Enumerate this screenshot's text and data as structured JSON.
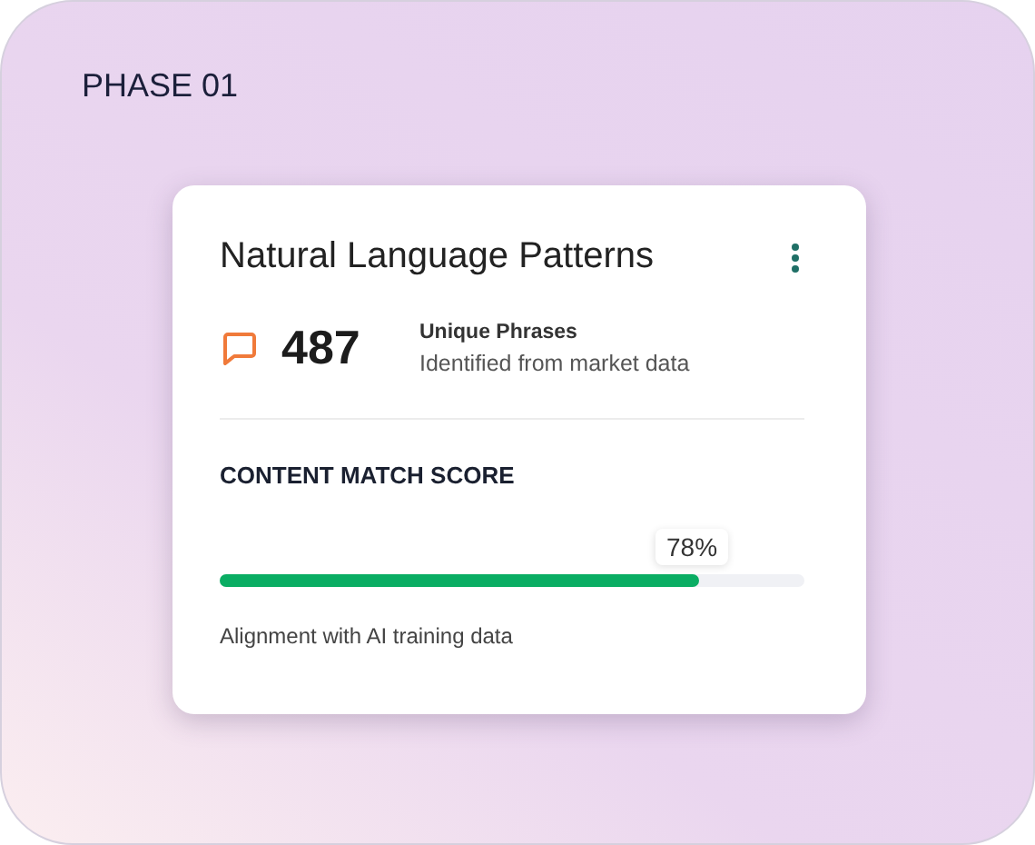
{
  "phase_label": "PHASE 01",
  "card": {
    "title": "Natural Language Patterns",
    "stat": {
      "value": "487",
      "label": "Unique Phrases",
      "caption": "Identified from market data"
    },
    "score": {
      "heading": "CONTENT MATCH SCORE",
      "reading": "78%",
      "level": 0.82,
      "caption": "Alignment with AI training data"
    }
  }
}
